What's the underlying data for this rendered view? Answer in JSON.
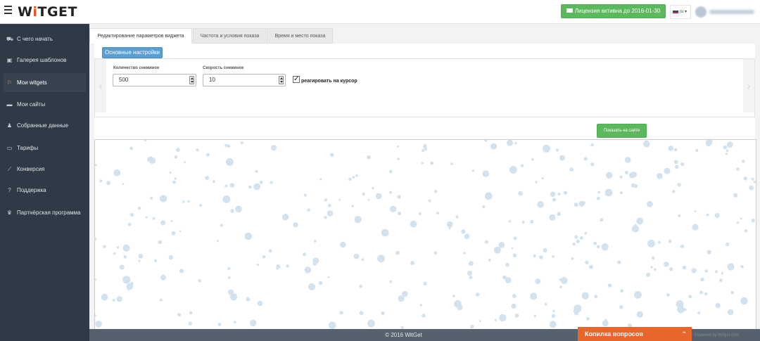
{
  "header": {
    "logo_text": "WiTGET",
    "license_label": "Лицензия активна до 2016-01-30",
    "lang": "ru"
  },
  "sidebar": {
    "items": [
      {
        "label": "С чего начать",
        "icon": "car-icon",
        "glyph": "⛟",
        "active": false
      },
      {
        "label": "Галерея шаблонов",
        "icon": "gallery-icon",
        "glyph": "▣",
        "active": false
      },
      {
        "label": "Мои witgets",
        "icon": "flag-icon",
        "glyph": "⚐",
        "active": true
      },
      {
        "label": "Мои сайты",
        "icon": "folder-icon",
        "glyph": "▬",
        "active": false
      },
      {
        "label": "Собранные данные",
        "icon": "user-icon",
        "glyph": "♟",
        "active": false
      },
      {
        "label": "Тарифы",
        "icon": "money-icon",
        "glyph": "▭",
        "active": false
      },
      {
        "label": "Конверсия",
        "icon": "chart-icon",
        "glyph": "⟋",
        "active": false
      },
      {
        "label": "Поддержка",
        "icon": "question-icon",
        "glyph": "?",
        "active": false
      },
      {
        "label": "Партнёрская программа",
        "icon": "trophy-icon",
        "glyph": "♛",
        "active": false
      }
    ]
  },
  "tabs": [
    {
      "label": "Редактирование параметров виджета",
      "active": true
    },
    {
      "label": "Частота и условия показа",
      "active": false
    },
    {
      "label": "Время и место показа",
      "active": false
    }
  ],
  "settings": {
    "subtab_label": "Основные настройки",
    "snow_count_label": "Количество снежинок",
    "snow_count_value": "500",
    "snow_speed_label": "Скорость снежинок",
    "snow_speed_value": "10",
    "cursor_label": "реагировать на курсор",
    "cursor_checked": true
  },
  "show_button_label": "Показать на сайте",
  "footer": {
    "copyright": "© 2016 WitGet",
    "questions_label": "Копилка вопросов",
    "powered": "Powered by Witget.com"
  },
  "colors": {
    "sidebar_bg": "#2f3a46",
    "green": "#5cb85c",
    "blue": "#5a9fd2",
    "orange": "#e8652b",
    "snow": "#d2e2ee"
  }
}
